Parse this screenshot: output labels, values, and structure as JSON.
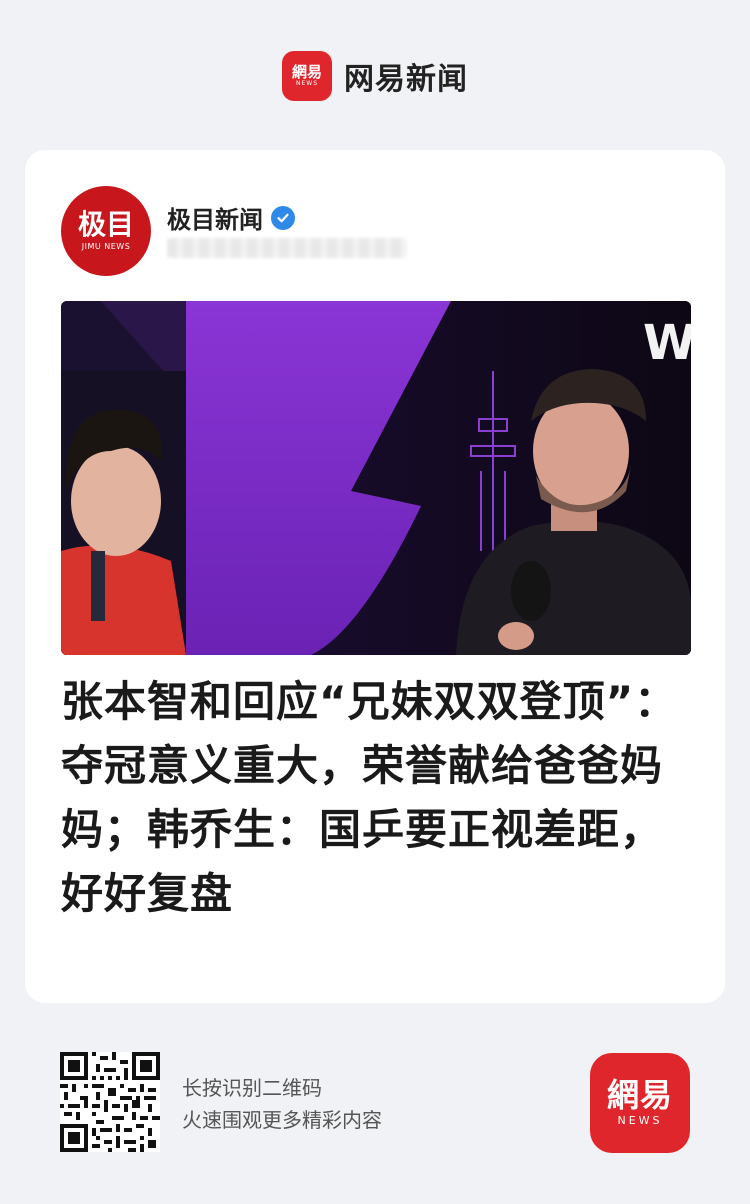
{
  "app": {
    "brand_cn": "網易",
    "brand_en": "NEWS",
    "name": "网易新闻"
  },
  "source": {
    "avatar_cn": "极目",
    "avatar_en": "JIMU NEWS",
    "name": "极目新闻",
    "verified_icon": "verified-check-icon"
  },
  "article": {
    "image_description_icon": "video-still",
    "image_overlay_text": "W",
    "title": "张本智和回应“兄妹双双登顶”：夺冠意义重大，荣誉献给爸爸妈妈；韩乔生：国乒要正视差距，好好复盘"
  },
  "footer": {
    "qr_line1": "长按识别二维码",
    "qr_line2": "火速围观更多精彩内容",
    "brand_cn": "網易",
    "brand_en": "NEWS"
  },
  "colors": {
    "brand_red": "#e0262d",
    "source_red": "#c8161d",
    "verified_blue": "#2e8ae6",
    "page_bg": "#f1f2f5"
  }
}
